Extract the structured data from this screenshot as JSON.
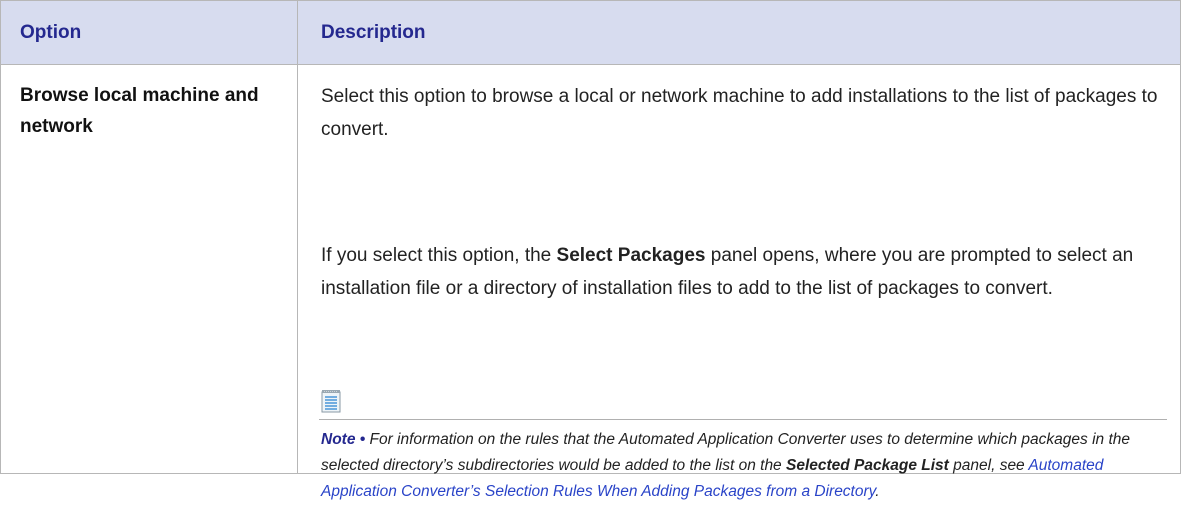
{
  "header": {
    "option_label": "Option",
    "description_label": "Description"
  },
  "row": {
    "option": "Browse local machine and network",
    "para1": "Select this option to browse a local or network machine to add installations to the list of packages to convert.",
    "para2_before": "If you select this option, the ",
    "para2_bold": "Select Packages",
    "para2_after": " panel opens, where you are prompted to select an installation file or a directory of installation files to add to the list of packages to convert.",
    "note": {
      "icon": "note-icon",
      "label": "Note •",
      "text_before": " For information on the rules that the Automated Application Converter uses to determine which packages in the selected directory’s subdirectories would be added to the list on the ",
      "bold": "Selected Package List",
      "text_middle": " panel, see ",
      "link": "Automated Application Converter’s Selection Rules When Adding Packages from a Directory",
      "text_after": "."
    }
  },
  "colors": {
    "header_bg": "#d7dcef",
    "header_text": "#24288f",
    "link": "#2a44c8"
  }
}
